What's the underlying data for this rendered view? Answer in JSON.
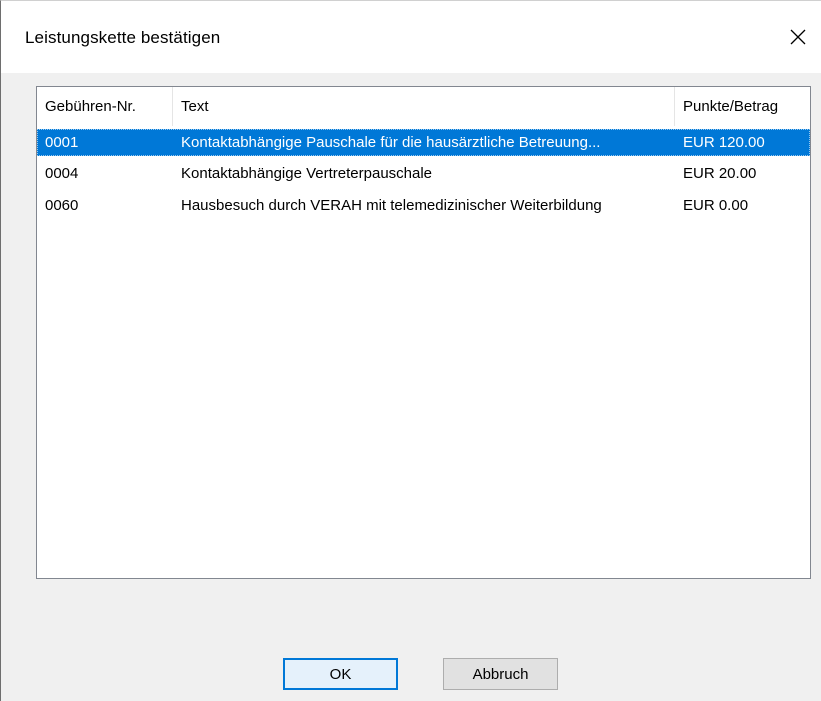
{
  "dialog": {
    "title": "Leistungskette bestätigen",
    "close_icon": "close-icon"
  },
  "list": {
    "columns": [
      "Gebühren-Nr.",
      "Text",
      "Punkte/Betrag"
    ],
    "rows": [
      {
        "nr": "0001",
        "text": "Kontaktabhängige Pauschale für die hausärztliche Betreuung...",
        "betrag": "EUR 120.00",
        "selected": true
      },
      {
        "nr": "0004",
        "text": "Kontaktabhängige Vertreterpauschale",
        "betrag": "EUR 20.00",
        "selected": false
      },
      {
        "nr": "0060",
        "text": "Hausbesuch durch VERAH mit telemedizinischer Weiterbildung",
        "betrag": "EUR 0.00",
        "selected": false
      }
    ],
    "selection_color": "#0078d7"
  },
  "buttons": {
    "ok_label": "OK",
    "cancel_label": "Abbruch"
  }
}
